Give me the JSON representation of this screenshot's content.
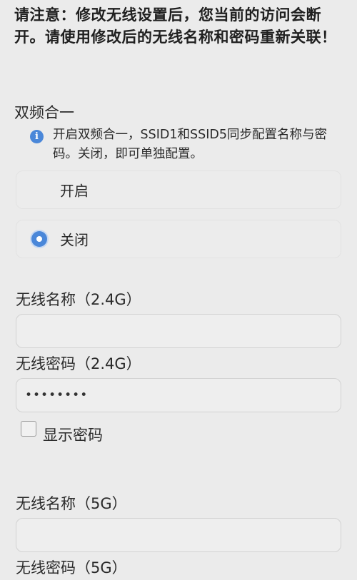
{
  "warning": "请注意：修改无线设置后，您当前的访问会断开。请使用修改后的无线名称和密码重新关联！",
  "dual_band": {
    "title": "双频合一",
    "info": "开启双频合一，SSID1和SSID5同步配置名称与密码。关闭，即可单独配置。",
    "options": [
      {
        "label": "开启",
        "selected": false
      },
      {
        "label": "关闭",
        "selected": true
      }
    ],
    "info_icon": "info-icon"
  },
  "wifi_24": {
    "name_label": "无线名称（2.4G）",
    "name_value": "",
    "password_label": "无线密码（2.4G）",
    "password_value": "••••••••"
  },
  "show_password": {
    "label": "显示密码",
    "checked": false
  },
  "wifi_5": {
    "name_label": "无线名称（5G）",
    "name_value": "",
    "password_label": "无线密码（5G）"
  },
  "colors": {
    "accent": "#4a87d9",
    "background": "#ebebeb"
  }
}
